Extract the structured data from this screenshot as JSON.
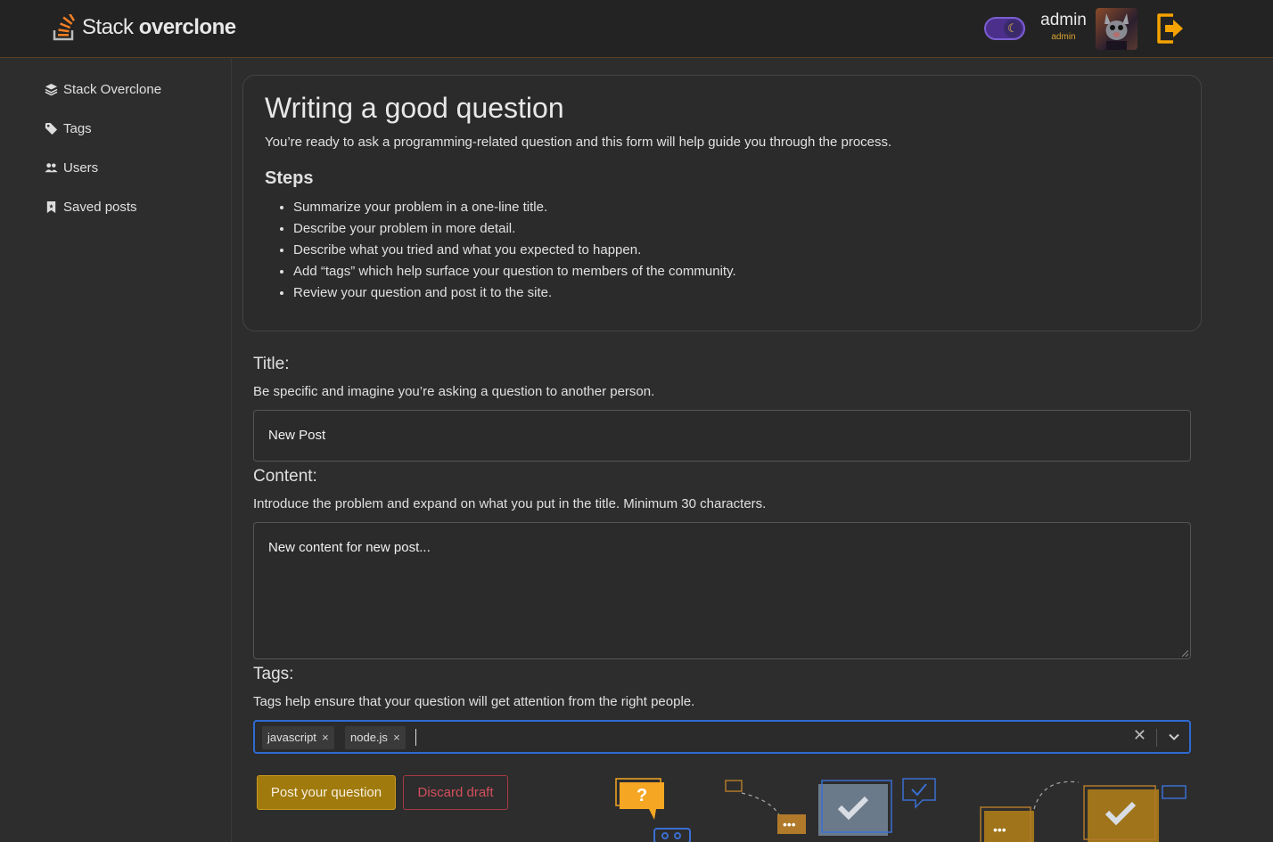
{
  "header": {
    "brand_light": "Stack ",
    "brand_bold": "overclone",
    "user_name": "admin",
    "user_role": "admin"
  },
  "sidebar": {
    "items": [
      {
        "label": "Stack Overclone",
        "icon": "layers-icon"
      },
      {
        "label": "Tags",
        "icon": "tag-icon"
      },
      {
        "label": "Users",
        "icon": "users-icon"
      },
      {
        "label": "Saved posts",
        "icon": "bookmark-icon"
      }
    ]
  },
  "guide": {
    "title": "Writing a good question",
    "intro": "You’re ready to ask a programming-related question and this form will help guide you through the process.",
    "steps_heading": "Steps",
    "steps": [
      "Summarize your problem in a one-line title.",
      "Describe your problem in more detail.",
      "Describe what you tried and what you expected to happen.",
      "Add “tags” which help surface your question to members of the community.",
      "Review your question and post it to the site."
    ]
  },
  "form": {
    "title_label": "Title:",
    "title_hint": "Be specific and imagine you’re asking a question to another person.",
    "title_value": "New Post",
    "content_label": "Content:",
    "content_hint": "Introduce the problem and expand on what you put in the title. Minimum 30 characters.",
    "content_value": "New content for new post...",
    "tags_label": "Tags:",
    "tags_hint": "Tags help ensure that your question will get attention from the right people.",
    "tags": [
      "javascript",
      "node.js"
    ],
    "post_button": "Post your question",
    "discard_button": "Discard draft"
  },
  "colors": {
    "accent": "#f48024",
    "post_button_bg": "#a17a0d",
    "discard": "#d4505c",
    "focus_border": "#2e6bd1"
  }
}
